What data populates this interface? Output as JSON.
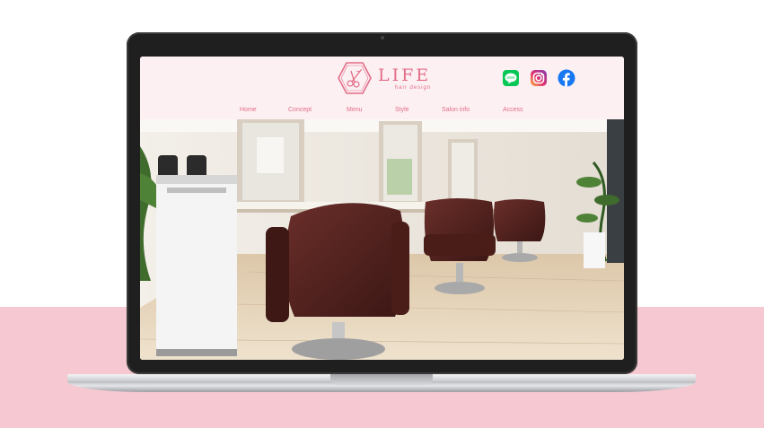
{
  "site": {
    "logo_title": "LIFE",
    "logo_subtitle": "hair design"
  },
  "nav": {
    "items": [
      {
        "label": "Home"
      },
      {
        "label": "Concept"
      },
      {
        "label": "Menu"
      },
      {
        "label": "Style"
      },
      {
        "label": "Salon info"
      },
      {
        "label": "Access"
      }
    ]
  },
  "social": {
    "icons": [
      "line-icon",
      "instagram-icon",
      "facebook-icon"
    ]
  },
  "colors": {
    "brand_pink": "#e46c86",
    "header_bg": "#fcf0f3",
    "band_pink": "#f6c8d1",
    "line_green": "#06c755",
    "facebook_blue": "#1877f2"
  },
  "hero": {
    "image": "salon-interior-photo"
  }
}
